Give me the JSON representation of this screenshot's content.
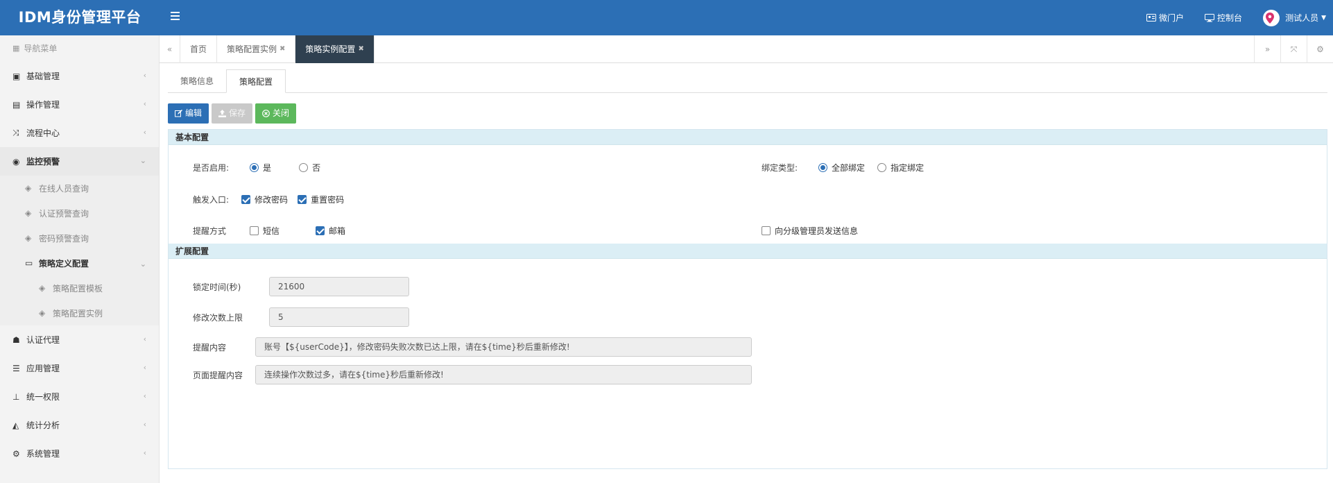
{
  "app": {
    "title": "IDM身份管理平台"
  },
  "topnav": {
    "portal": "微门户",
    "console": "控制台",
    "user": "测试人员"
  },
  "sidebar": {
    "header": "导航菜单",
    "items": [
      {
        "label": "基础管理"
      },
      {
        "label": "操作管理"
      },
      {
        "label": "流程中心"
      },
      {
        "label": "监控预警"
      },
      {
        "label": "在线人员查询"
      },
      {
        "label": "认证预警查询"
      },
      {
        "label": "密码预警查询"
      },
      {
        "label": "策略定义配置"
      },
      {
        "label": "策略配置模板"
      },
      {
        "label": "策略配置实例"
      },
      {
        "label": "认证代理"
      },
      {
        "label": "应用管理"
      },
      {
        "label": "统一权限"
      },
      {
        "label": "统计分析"
      },
      {
        "label": "系统管理"
      }
    ]
  },
  "tabs": [
    {
      "label": "首页"
    },
    {
      "label": "策略配置实例"
    },
    {
      "label": "策略实例配置"
    }
  ],
  "subtabs": [
    {
      "label": "策略信息"
    },
    {
      "label": "策略配置"
    }
  ],
  "toolbar": {
    "edit": "编辑",
    "save": "保存",
    "close": "关闭"
  },
  "basic": {
    "title": "基本配置",
    "enable_label": "是否启用:",
    "enable_yes": "是",
    "enable_no": "否",
    "bind_label": "绑定类型:",
    "bind_all": "全部绑定",
    "bind_specific": "指定绑定",
    "trigger_label": "触发入口:",
    "trigger_change": "修改密码",
    "trigger_reset": "重置密码",
    "remind_label": "提醒方式",
    "remind_sms": "短信",
    "remind_mail": "邮箱",
    "remind_admin": "向分级管理员发送信息"
  },
  "ext": {
    "title": "扩展配置",
    "lock_label": "锁定时间(秒)",
    "lock_value": "21600",
    "limit_label": "修改次数上限",
    "limit_value": "5",
    "msg_label": "提醒内容",
    "msg_value": "账号【${userCode}】，修改密码失败次数已达上限，请在${time}秒后重新修改!",
    "page_label": "页面提醒内容",
    "page_value": "连续操作次数过多，请在${time}秒后重新修改!"
  }
}
